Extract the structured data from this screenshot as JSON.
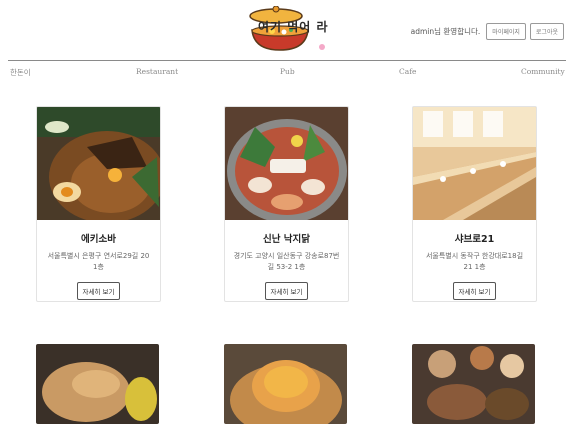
{
  "header": {
    "logo_text": "여기 먹어 라",
    "welcome": "admin님 환영합니다.",
    "mypage_label": "마이페이지",
    "logout_label": "로그아웃"
  },
  "nav": {
    "items": [
      {
        "label": "한돈이"
      },
      {
        "label": "Restaurant"
      },
      {
        "label": "Pub"
      },
      {
        "label": "Cafe"
      },
      {
        "label": "Community"
      }
    ]
  },
  "cards": [
    {
      "name": "에키소바",
      "address": "서울특별시 은평구 연서로29길 20 1층",
      "button": "자세히 보기"
    },
    {
      "name": "신난 낙지닭",
      "address": "경기도 고양시 일산동구 강송로87번길 53-2 1층",
      "button": "자세히 보기"
    },
    {
      "name": "샤브로21",
      "address": "서울특별시 동작구 한강대로18길 21 1층",
      "button": "자세히 보기"
    }
  ],
  "colors": {
    "border": "#e3e3e3",
    "nav_text": "#8a8a8a",
    "logo_pot": "#e89a2c"
  }
}
